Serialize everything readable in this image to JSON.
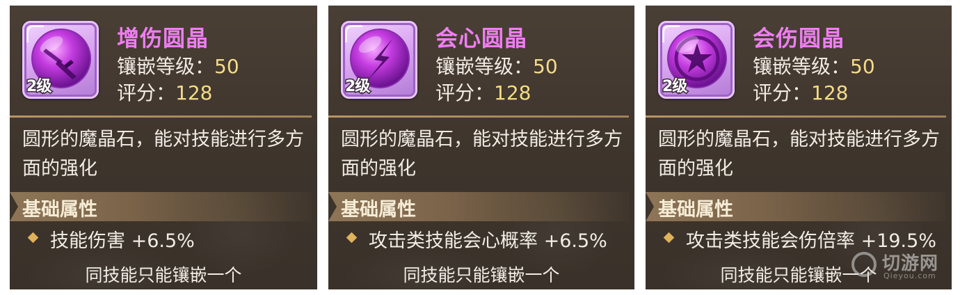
{
  "cards": [
    {
      "title": "增伤圆晶",
      "icon": "sword-orb-icon",
      "level_badge": "2级",
      "socket_level_label": "镶嵌等级：",
      "socket_level_value": "50",
      "score_label": "评分：",
      "score_value": "128",
      "description": "圆形的魔晶石，能对技能进行多方面的强化",
      "section_title": "基础属性",
      "attribute": "技能伤害 +6.5%",
      "note": "同技能只能镶嵌一个"
    },
    {
      "title": "会心圆晶",
      "icon": "lightning-orb-icon",
      "level_badge": "2级",
      "socket_level_label": "镶嵌等级：",
      "socket_level_value": "50",
      "score_label": "评分：",
      "score_value": "128",
      "description": "圆形的魔晶石，能对技能进行多方面的强化",
      "section_title": "基础属性",
      "attribute": "攻击类技能会心概率 +6.5%",
      "note": "同技能只能镶嵌一个"
    },
    {
      "title": "会伤圆晶",
      "icon": "star-orb-icon",
      "level_badge": "2级",
      "socket_level_label": "镶嵌等级：",
      "socket_level_value": "50",
      "score_label": "评分：",
      "score_value": "128",
      "description": "圆形的魔晶石，能对技能进行多方面的强化",
      "section_title": "基础属性",
      "attribute": "攻击类技能会伤倍率 +19.5%",
      "note": "同技能只能镶嵌一个"
    }
  ],
  "watermark": {
    "text": "切游网",
    "sub": "Qieyou.com"
  },
  "colors": {
    "title": "#ee7ef2",
    "value": "#f4dc8a",
    "panel": "#3d342c",
    "bullet": "#e0b25a"
  }
}
